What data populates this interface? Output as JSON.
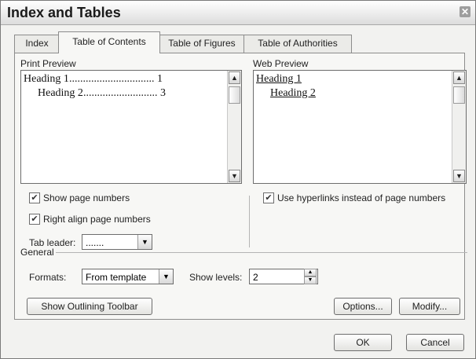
{
  "window": {
    "title": "Index and Tables"
  },
  "tabs": [
    {
      "label": "Index"
    },
    {
      "label": "Table of Contents"
    },
    {
      "label": "Table of Figures"
    },
    {
      "label": "Table of Authorities"
    }
  ],
  "print_preview": {
    "label": "Print Preview",
    "lines": [
      {
        "text": "Heading 1",
        "dots": "...............................",
        "page": "1"
      },
      {
        "text": "Heading 2",
        "dots": "...........................",
        "page": "3"
      }
    ]
  },
  "web_preview": {
    "label": "Web Preview",
    "links": [
      "Heading 1",
      "Heading 2"
    ]
  },
  "options": {
    "show_page_numbers": {
      "label": "Show page numbers",
      "checked": true
    },
    "right_align": {
      "label": "Right align page numbers",
      "checked": true
    },
    "use_hyperlinks": {
      "label": "Use hyperlinks instead of page numbers",
      "checked": true
    },
    "tab_leader": {
      "label": "Tab leader:",
      "value": "......."
    }
  },
  "general": {
    "label": "General",
    "formats_label": "Formats:",
    "formats_value": "From template",
    "levels_label": "Show levels:",
    "levels_value": "2"
  },
  "buttons": {
    "outlining": "Show Outlining Toolbar",
    "options": "Options...",
    "modify": "Modify...",
    "ok": "OK",
    "cancel": "Cancel"
  }
}
